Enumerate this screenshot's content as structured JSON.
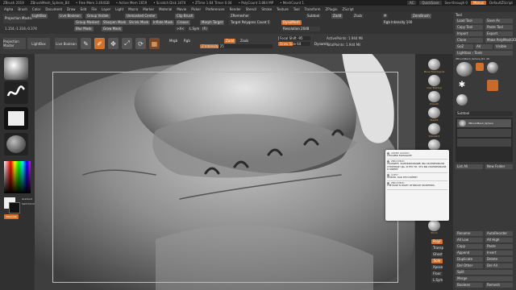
{
  "title_bar": {
    "app": "ZBrush 2019",
    "file": "ZBrushMesh_Sphere_B4",
    "stats": [
      "• Free Mem 3.404GB",
      "• Active Mem 1659",
      "• Scratch Disk 3474",
      "• ZTime 1.64 Timer 0.04",
      "• PolyCount 3.884 MP",
      "• MeshCount 1"
    ],
    "ac": "AC",
    "quicksave": "QuickSave",
    "see_through": "See-through 0",
    "menus": "Menus",
    "default_zscript": "DefaultZScript"
  },
  "menu_bar": [
    "Alpha",
    "Brush",
    "Color",
    "Document",
    "Draw",
    "Edit",
    "File",
    "Layer",
    "Light",
    "Macro",
    "Marker",
    "Material",
    "Movie",
    "Picker",
    "Preferences",
    "Render",
    "Stencil",
    "Stroke",
    "Texture",
    "Tool",
    "Transform",
    "ZPlugin",
    "ZScript"
  ],
  "toolbar": {
    "projection_master": "Projection Master",
    "lightbox": "LightBox",
    "live_boolean": "Live Boolean",
    "group_visible": "Group Visible",
    "unmasked_center": "Unmasked Center",
    "clip_brush": "Clip Brush",
    "group_masked": "Group Masked",
    "sharpen_mask": "Sharpen Mask",
    "blur_mask": "Blur Mask",
    "grow_mask": "Grow Mask",
    "shrink_mask": "Shrink Mask",
    "inflate_mask": "Inflate Mask",
    "crease": "Crease",
    "morph_target": "Morph Target",
    "symmetry_btn": ">X<",
    "local_sym": "L.Sym",
    "circle_sym": "(R)",
    "zremesher": "ZRemesher",
    "target_polygons": "Target Polygons Count 5",
    "dynamesh": "DynaMesh",
    "resolution": "Resolution 2048",
    "focal_shift": "Focal Shift -95",
    "draw_size": "Draw Size 64",
    "dynamic": "Dynamic",
    "active_points": "ActivePoints: 1.944 Mil",
    "total_points": "TotalPoints: 1.944 Mil",
    "z_intensity": "Z Intensity 25",
    "rgb_intensity": "Rgb Intensity 100",
    "zadd": "Zadd",
    "zsub": "Zsub",
    "mrgb": "Mrgb",
    "rgb": "Rgb",
    "m": "M",
    "draw": "Draw",
    "move": "Move",
    "scale": "Scale",
    "rotate": "Rotate",
    "edit": "Edit",
    "smt": "Smt",
    "zero_brush": "ZeroBrush",
    "subtool_label": "Subtool",
    "coords": "1.154,-1.318,-0.374"
  },
  "left_tray": {
    "brush_label": "ClayBuildup",
    "stroke_label": "FreeHand",
    "alpha_label": "Alpha Off",
    "texture_label": "Texture Off",
    "material_label": "SkinShade4",
    "gradient": "Gradient",
    "switch_color": "SwitchColor",
    "alternate": "Alternate",
    "color_main": "#f0f0f0",
    "color_secondary": "#111111"
  },
  "right_tray": {
    "items": [
      "Move Topological",
      "Clay Buildup",
      "Smooth",
      "Slash3",
      "Standard",
      "DamStandard",
      "Dam_Standard",
      "Move",
      "Inflate",
      "hPolish",
      "Pinch"
    ],
    "bottom": [
      "Transp",
      "Ghost",
      "Solo",
      "Xpose",
      "Floor",
      "L.Sym",
      "PolyF"
    ]
  },
  "palette": {
    "header": "Tool",
    "buttons": [
      "Load Tool",
      "Save As",
      "Copy Tool",
      "Paste Tool",
      "Import",
      "Export",
      "Clone",
      "Make PolyMesh3D",
      "GoZ",
      "All",
      "Visible",
      "R",
      "Lightbox › Tools"
    ],
    "tool_name": "ZBrushMesh_Sphere_B4. 48",
    "subtool": "Subtool",
    "subtool_name": "ZBrushMesh_Sphere",
    "geometry": "Geometry",
    "list_all": "List All",
    "new_folder": "New Folder",
    "bottom_buttons": [
      "Rename",
      "AutoReorder",
      "All Low",
      "All High",
      "Copy",
      "Paste",
      "Append",
      "Insert",
      "Duplicate",
      "Delete",
      "Del Other",
      "Del All",
      "Split",
      "Merge",
      "Boolean",
      "Remesh",
      "Project",
      "Extract"
    ]
  },
  "chat": {
    "messages": [
      {
        "who": "ANDREI LOGINOV",
        "text": "СПАСИБО БОЛЬШОЕ!"
      },
      {
        "who": "ZBRUSHBUD",
        "text": "СКАЖИТЕ, ЗАЛЕЖИЛАВШИЕ, ВЫ СКОПИРОВАЛИ СТРАНИЦУ? ДА, И ЭТО ТО, ЧТО ВЫ СКОПИРОВАЛИ, Я ЗАБЕРУ"
      },
      {
        "who": "GUEST",
        "text": "НУЖНО, КАК ЭТО НАЙТИ?"
      },
      {
        "who": "ZBRUSHBUD",
        "text": "THE EASE IS RIGHT OF BRUSH MODIFIERS."
      }
    ]
  }
}
